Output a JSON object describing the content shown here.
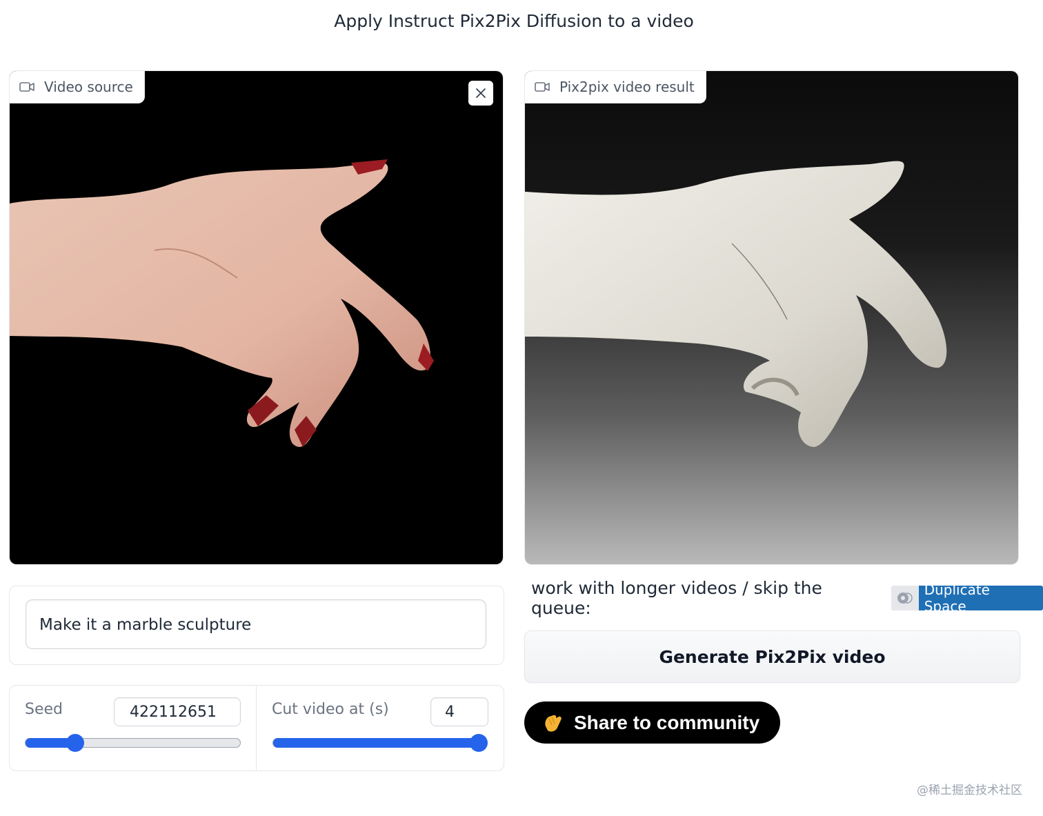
{
  "page": {
    "title": "Apply Instruct Pix2Pix Diffusion to a video"
  },
  "input_video": {
    "label": "Video source",
    "icon": "video-camera-icon",
    "close_icon": "close-icon"
  },
  "output_video": {
    "label": "Pix2pix video result",
    "icon": "video-camera-icon"
  },
  "prompt": {
    "value": "Make it a marble sculpture"
  },
  "seed": {
    "label": "Seed",
    "value": "422112651",
    "slider_fraction": 0.23
  },
  "cut": {
    "label": "Cut video at (s)",
    "value": "4",
    "slider_fraction": 1.0
  },
  "duplicate": {
    "text": "work with longer videos / skip the queue:",
    "badge_label": "Duplicate Space"
  },
  "generate": {
    "label": "Generate Pix2Pix video"
  },
  "share": {
    "label": "Share to community",
    "icon": "clapping-hands-icon"
  },
  "watermark": "@稀土掘金技术社区",
  "colors": {
    "accent": "#2563eb",
    "duplicate_badge": "#1f6fb5",
    "share_bg": "#000000"
  }
}
